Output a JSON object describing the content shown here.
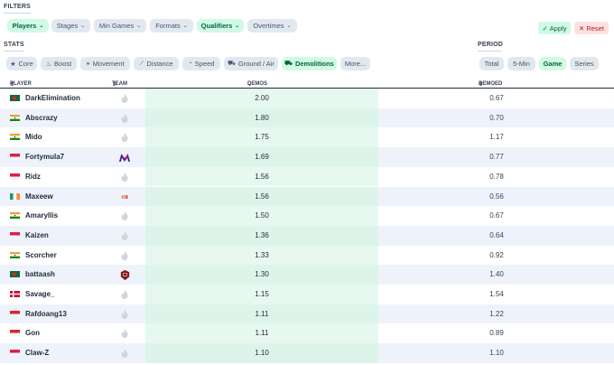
{
  "filters": {
    "title": "FILTERS",
    "chips": [
      {
        "label": "Players",
        "active": true
      },
      {
        "label": "Stages",
        "active": false
      },
      {
        "label": "Min Games",
        "active": false
      },
      {
        "label": "Formats",
        "active": false
      },
      {
        "label": "Qualifiers",
        "active": true
      },
      {
        "label": "Overtimes",
        "active": false
      }
    ],
    "apply_label": "Apply",
    "reset_label": "Reset"
  },
  "stats": {
    "title": "STATS",
    "tabs": [
      {
        "label": "Core",
        "icon": "star-icon",
        "active": false
      },
      {
        "label": "Boost",
        "icon": "flame-icon",
        "active": false
      },
      {
        "label": "Movement",
        "icon": "runner-icon",
        "active": false
      },
      {
        "label": "Distance",
        "icon": "ruler-icon",
        "active": false
      },
      {
        "label": "Speed",
        "icon": "gauge-icon",
        "active": false
      },
      {
        "label": "Ground / Air",
        "icon": "car-icon",
        "active": false
      },
      {
        "label": "Demolitions",
        "icon": "crash-icon",
        "active": true
      },
      {
        "label": "More...",
        "icon": "",
        "active": false
      }
    ]
  },
  "period": {
    "title": "PERIOD",
    "options": [
      {
        "label": "Total",
        "active": false
      },
      {
        "label": "5-Min",
        "active": false
      },
      {
        "label": "Game",
        "active": true
      },
      {
        "label": "Series",
        "active": false
      }
    ]
  },
  "table": {
    "columns": {
      "player": "PLAYER",
      "team": "TEAM",
      "demos": "DEMOS",
      "demoed": "DEMOED"
    },
    "rows": [
      {
        "player": "DarkElimination",
        "flag": "bd",
        "team": "flame",
        "demos": "2.00",
        "demoed": "0.67"
      },
      {
        "player": "Abscrazy",
        "flag": "in",
        "team": "flame",
        "demos": "1.80",
        "demoed": "0.70"
      },
      {
        "player": "Mido",
        "flag": "in",
        "team": "flame",
        "demos": "1.75",
        "demoed": "1.17"
      },
      {
        "player": "Fortymula7",
        "flag": "sg",
        "team": "m-logo",
        "demos": "1.69",
        "demoed": "0.77"
      },
      {
        "player": "Ridz",
        "flag": "sg",
        "team": "flame",
        "demos": "1.56",
        "demoed": "0.78"
      },
      {
        "player": "Maxeew",
        "flag": "ie",
        "team": "small-logo",
        "demos": "1.56",
        "demoed": "0.56"
      },
      {
        "player": "Amaryllis",
        "flag": "in",
        "team": "flame",
        "demos": "1.50",
        "demoed": "0.67"
      },
      {
        "player": "Kaizen",
        "flag": "sg",
        "team": "flame",
        "demos": "1.36",
        "demoed": "0.64"
      },
      {
        "player": "Scorcher",
        "flag": "in",
        "team": "flame",
        "demos": "1.33",
        "demoed": "0.92"
      },
      {
        "player": "battaash",
        "flag": "bd",
        "team": "badge-logo",
        "demos": "1.30",
        "demoed": "1.40"
      },
      {
        "player": "Savage_",
        "flag": "dk",
        "team": "flame",
        "demos": "1.15",
        "demoed": "1.54"
      },
      {
        "player": "Rafdoang13",
        "flag": "id",
        "team": "flame",
        "demos": "1.11",
        "demoed": "1.22"
      },
      {
        "player": "Gon",
        "flag": "id",
        "team": "flame",
        "demos": "1.11",
        "demoed": "0.89"
      },
      {
        "player": "Claw-Z",
        "flag": "sg",
        "team": "flame",
        "demos": "1.10",
        "demoed": "1.10"
      }
    ]
  }
}
